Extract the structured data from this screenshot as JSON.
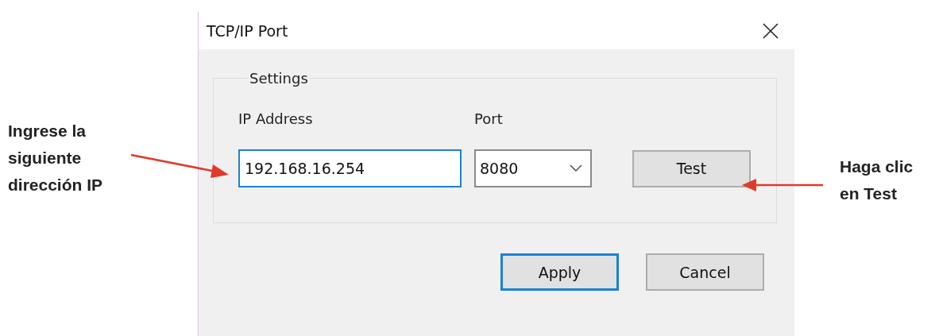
{
  "window": {
    "title": "TCP/IP Port"
  },
  "left_note": {
    "lines": [
      "Ingrese la",
      "siguiente",
      "dirección IP"
    ]
  },
  "right_note": {
    "lines": [
      "Haga clic",
      "en Test"
    ]
  },
  "settings": {
    "legend": "Settings",
    "ip_label": "IP Address",
    "ip_value": "192.168.16.254",
    "ip_focused": true,
    "port_label": "Port",
    "port_value": "8080",
    "test_button": "Test"
  },
  "buttons": [
    {
      "label": "Apply",
      "default": true
    },
    {
      "label": "Cancel",
      "default": false
    }
  ]
}
